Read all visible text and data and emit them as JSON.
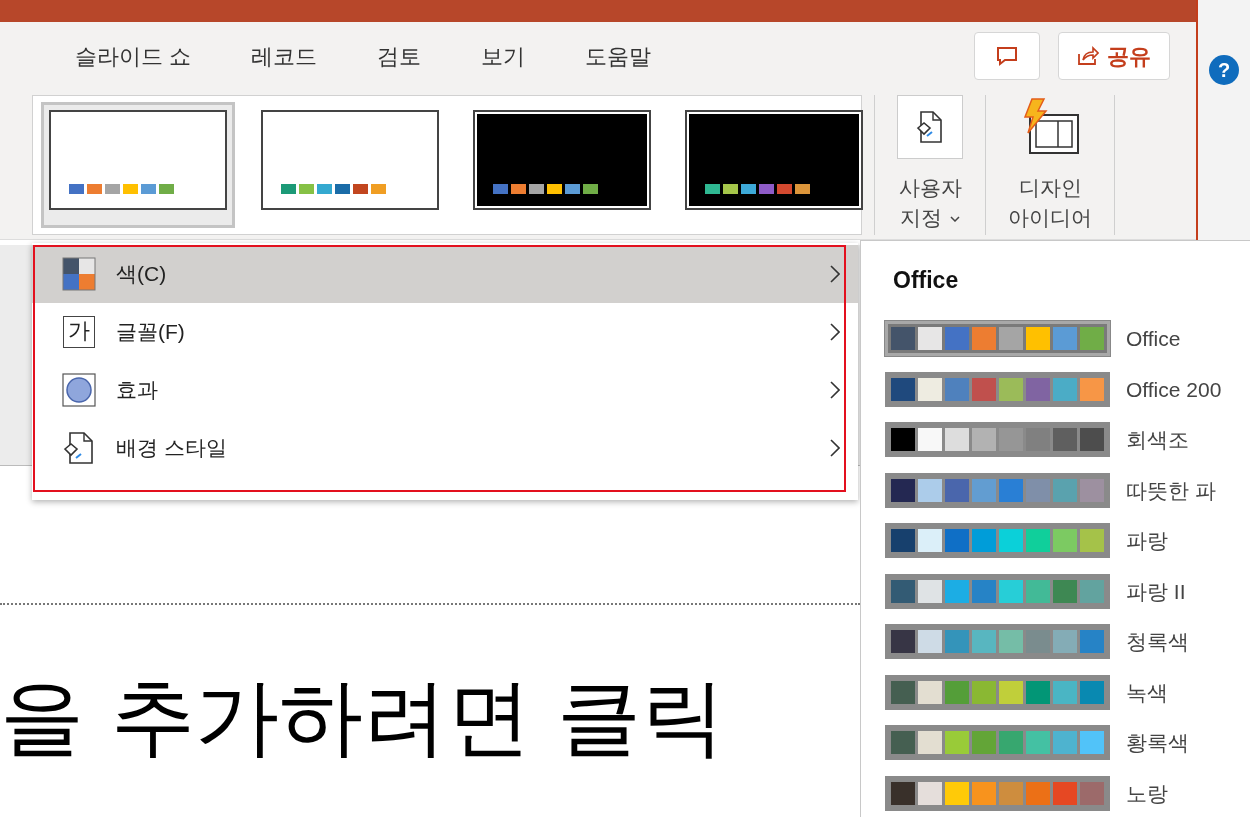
{
  "tabs": [
    {
      "label": "슬라이드 쇼",
      "selected": false
    },
    {
      "label": "레코드",
      "selected": false
    },
    {
      "label": "검토",
      "selected": false
    },
    {
      "label": "보기",
      "selected": false
    },
    {
      "label": "도움말",
      "selected": false
    }
  ],
  "share_button": {
    "label": "공유"
  },
  "help": {
    "glyph": "?"
  },
  "theme_gallery": [
    {
      "dark": false,
      "selected": true,
      "swatches": [
        {
          "color": "#4472c4"
        },
        {
          "color": "#ed7d31"
        },
        {
          "color": "#a5a5a5"
        },
        {
          "color": "#ffc000"
        },
        {
          "color": "#5b9bd5"
        },
        {
          "color": "#70ad47"
        }
      ]
    },
    {
      "dark": false,
      "selected": false,
      "swatches": [
        {
          "color": "#1c9a77"
        },
        {
          "color": "#86c145"
        },
        {
          "color": "#34a9d0"
        },
        {
          "color": "#1a6ca8"
        },
        {
          "color": "#c2461f"
        },
        {
          "color": "#f09e23"
        }
      ]
    },
    {
      "dark": true,
      "selected": false,
      "swatches": [
        {
          "color": "#4472c4"
        },
        {
          "color": "#ed7d31"
        },
        {
          "color": "#a5a5a5"
        },
        {
          "color": "#ffc000"
        },
        {
          "color": "#5b9bd5"
        },
        {
          "color": "#70ad47"
        }
      ]
    },
    {
      "dark": true,
      "selected": false,
      "swatches": [
        {
          "color": "#2fb892"
        },
        {
          "color": "#a5c64a"
        },
        {
          "color": "#3da9d8"
        },
        {
          "color": "#8e5bc7"
        },
        {
          "color": "#d4492f"
        },
        {
          "color": "#dc953a"
        }
      ]
    }
  ],
  "ribbon_buttons": [
    {
      "kind": "customize",
      "lines": [
        "사용자",
        "지정"
      ],
      "dropdown": true
    },
    {
      "kind": "design-ideas",
      "lines": [
        "디자인",
        "아이디어"
      ],
      "dropdown": false
    }
  ],
  "variant_menu": {
    "annotated": true,
    "items": [
      {
        "kind": "colors",
        "label": "색(C)",
        "selected": true
      },
      {
        "kind": "fonts",
        "label": "글꼴(F)",
        "icon_text": "가",
        "selected": false
      },
      {
        "kind": "effects",
        "label": "효과",
        "selected": false
      },
      {
        "kind": "background",
        "label": "배경 스타일",
        "selected": false
      }
    ]
  },
  "color_submenu": {
    "heading": "Office",
    "schemes": [
      {
        "label": "Office",
        "selected": true,
        "swatches": [
          {
            "color": "#44546a"
          },
          {
            "color": "#e7e6e6"
          },
          {
            "color": "#4472c4"
          },
          {
            "color": "#ed7d31"
          },
          {
            "color": "#a5a5a5"
          },
          {
            "color": "#ffc000"
          },
          {
            "color": "#5b9bd5"
          },
          {
            "color": "#70ad47"
          }
        ]
      },
      {
        "label": "Office 200",
        "selected": false,
        "swatches": [
          {
            "color": "#1f497d"
          },
          {
            "color": "#eeece1"
          },
          {
            "color": "#4f81bd"
          },
          {
            "color": "#c0504d"
          },
          {
            "color": "#9bbb59"
          },
          {
            "color": "#8064a2"
          },
          {
            "color": "#4bacc6"
          },
          {
            "color": "#f79646"
          }
        ]
      },
      {
        "label": "회색조",
        "selected": false,
        "swatches": [
          {
            "color": "#000000"
          },
          {
            "color": "#f8f8f8"
          },
          {
            "color": "#dddddd"
          },
          {
            "color": "#b2b2b2"
          },
          {
            "color": "#969696"
          },
          {
            "color": "#808080"
          },
          {
            "color": "#5f5f5f"
          },
          {
            "color": "#4d4d4d"
          }
        ]
      },
      {
        "label": "따뜻한 파",
        "selected": false,
        "swatches": [
          {
            "color": "#242852"
          },
          {
            "color": "#acccea"
          },
          {
            "color": "#4a66ac"
          },
          {
            "color": "#629dd1"
          },
          {
            "color": "#297fd5"
          },
          {
            "color": "#7f8fa9"
          },
          {
            "color": "#5aa2ae"
          },
          {
            "color": "#9d90a0"
          }
        ]
      },
      {
        "label": "파랑",
        "selected": false,
        "swatches": [
          {
            "color": "#17406d"
          },
          {
            "color": "#dbeff9"
          },
          {
            "color": "#0f6fc6"
          },
          {
            "color": "#009dd9"
          },
          {
            "color": "#0bd0d9"
          },
          {
            "color": "#10cf9b"
          },
          {
            "color": "#7cca62"
          },
          {
            "color": "#a5c249"
          }
        ]
      },
      {
        "label": "파랑 II",
        "selected": false,
        "swatches": [
          {
            "color": "#335b74"
          },
          {
            "color": "#dfe3e5"
          },
          {
            "color": "#1cade4"
          },
          {
            "color": "#2683c6"
          },
          {
            "color": "#27ced7"
          },
          {
            "color": "#42ba97"
          },
          {
            "color": "#3e8853"
          },
          {
            "color": "#62a39f"
          }
        ]
      },
      {
        "label": "청록색",
        "selected": false,
        "swatches": [
          {
            "color": "#373545"
          },
          {
            "color": "#cedbe6"
          },
          {
            "color": "#3494ba"
          },
          {
            "color": "#58b6c0"
          },
          {
            "color": "#75bda7"
          },
          {
            "color": "#7a8c8e"
          },
          {
            "color": "#84acb6"
          },
          {
            "color": "#2683c6"
          }
        ]
      },
      {
        "label": "녹색",
        "selected": false,
        "swatches": [
          {
            "color": "#455f51"
          },
          {
            "color": "#e3ded1"
          },
          {
            "color": "#549e39"
          },
          {
            "color": "#8ab833"
          },
          {
            "color": "#c0cf3a"
          },
          {
            "color": "#029676"
          },
          {
            "color": "#4ab5c4"
          },
          {
            "color": "#0989b1"
          }
        ]
      },
      {
        "label": "황록색",
        "selected": false,
        "swatches": [
          {
            "color": "#455f51"
          },
          {
            "color": "#e3ded1"
          },
          {
            "color": "#99cb38"
          },
          {
            "color": "#63a537"
          },
          {
            "color": "#37a76f"
          },
          {
            "color": "#44c1a3"
          },
          {
            "color": "#4eb3cf"
          },
          {
            "color": "#51c3f9"
          }
        ]
      },
      {
        "label": "노랑",
        "selected": false,
        "swatches": [
          {
            "color": "#39302a"
          },
          {
            "color": "#e5dedb"
          },
          {
            "color": "#ffca08"
          },
          {
            "color": "#f8931d"
          },
          {
            "color": "#ce8d3e"
          },
          {
            "color": "#ec7016"
          },
          {
            "color": "#e64823"
          },
          {
            "color": "#9c6a6a"
          }
        ]
      }
    ]
  },
  "slide": {
    "title_placeholder": "을 추가하려면 클릭"
  }
}
